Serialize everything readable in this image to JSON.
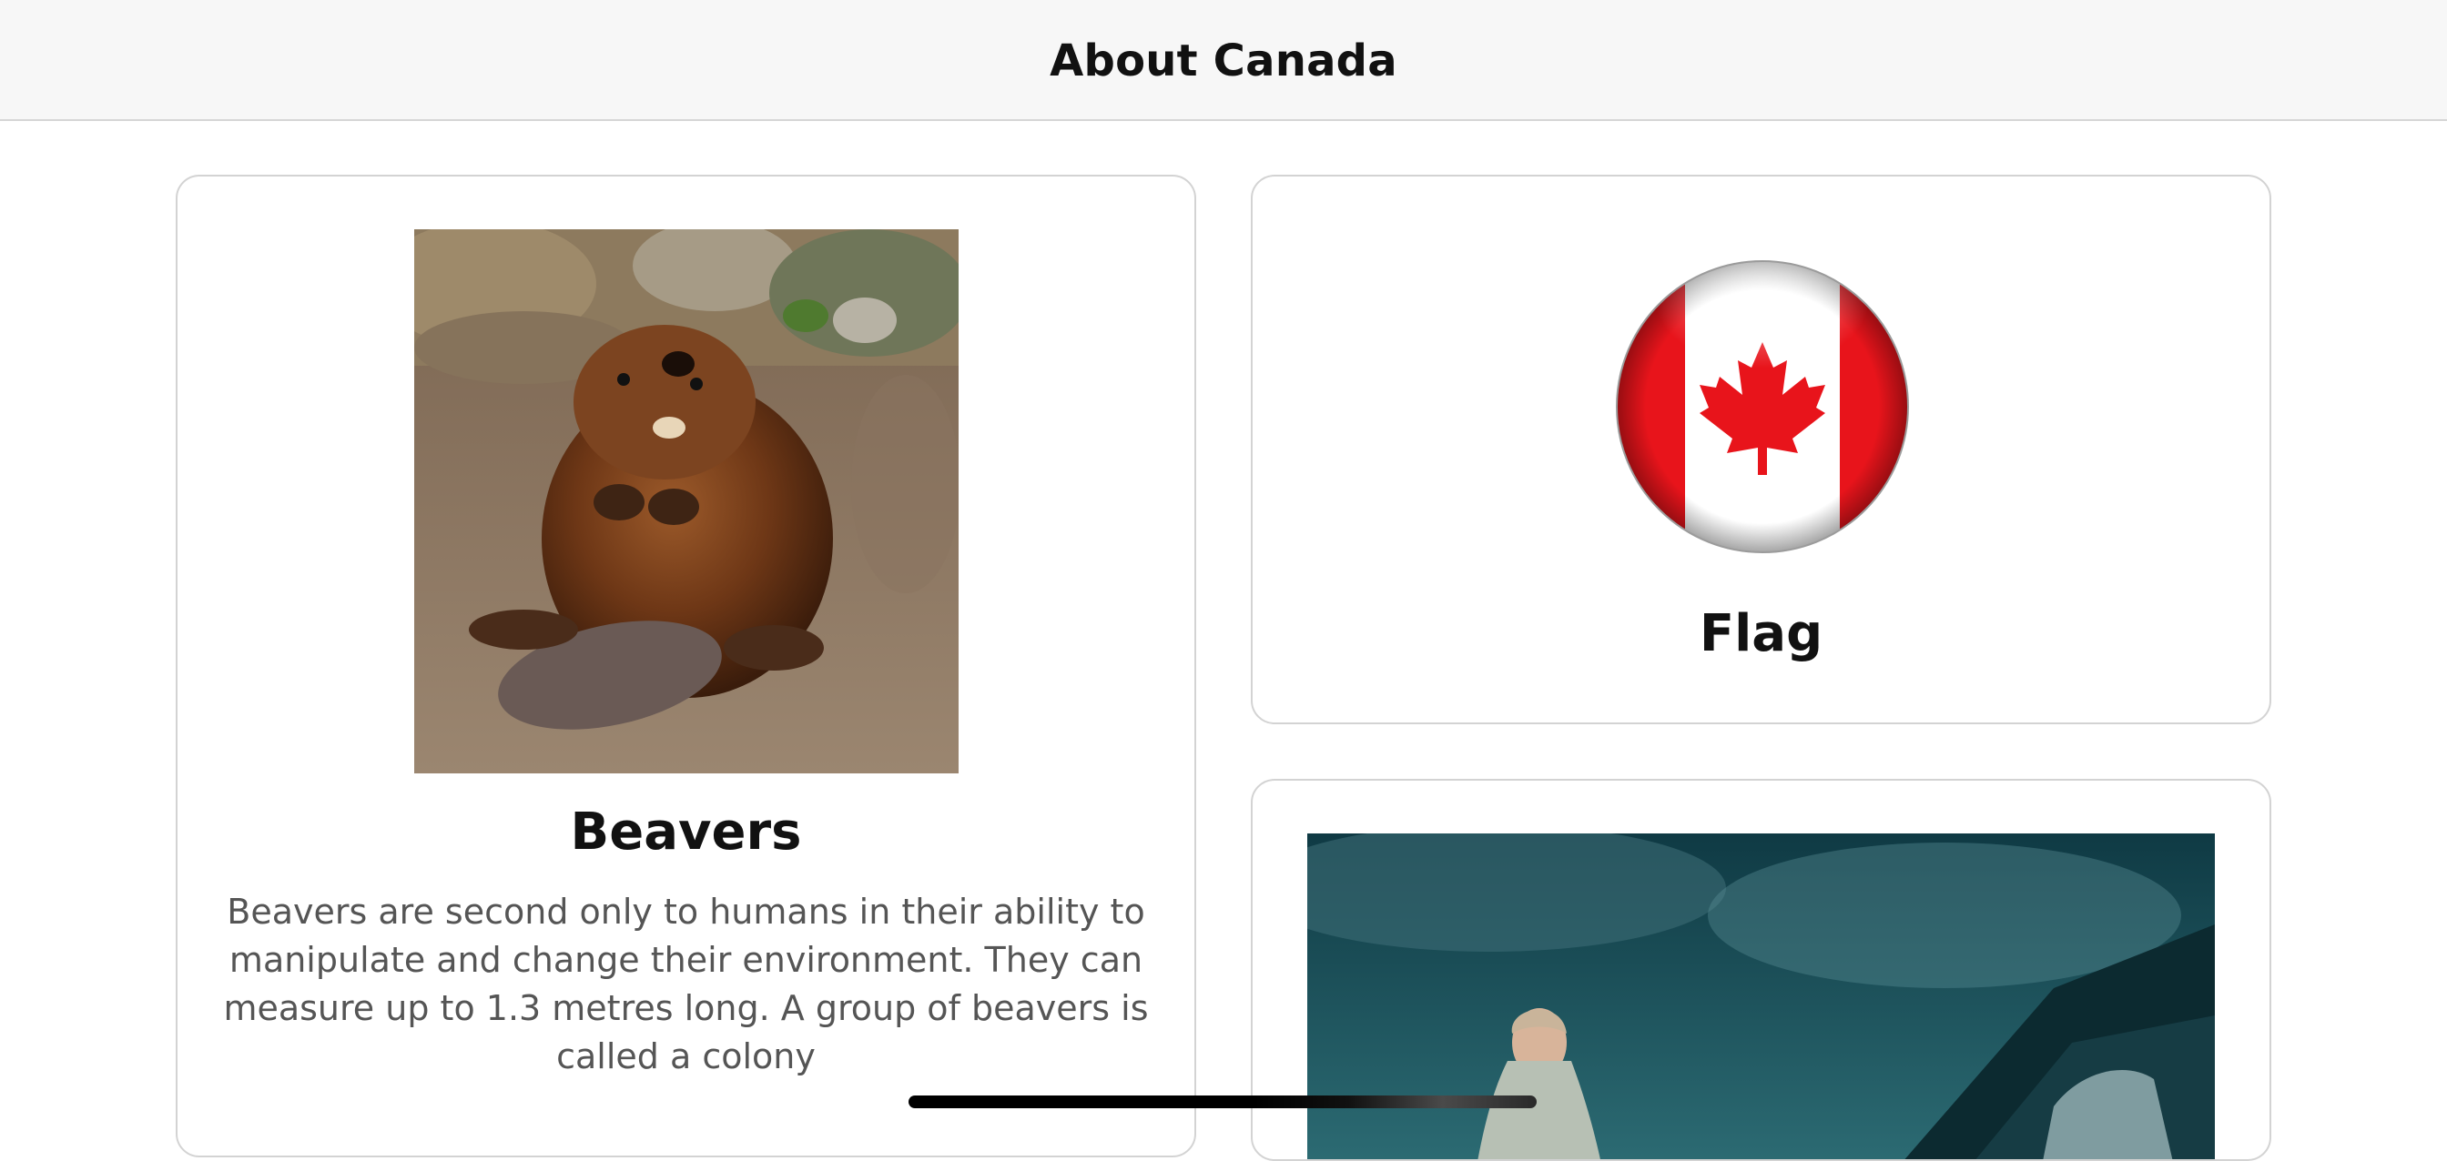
{
  "nav": {
    "title": "About Canada"
  },
  "cards": [
    {
      "title": "Beavers",
      "description": "Beavers are second only to humans in their ability to manipulate and change their environment. They can measure up to 1.3 metres long. A group of beavers is called a colony",
      "image": "beaver-photo"
    },
    {
      "title": "Flag",
      "image": "canada-flag-button"
    },
    {
      "image": "winter-scene-photo"
    }
  ],
  "colors": {
    "flag_red": "#e8141b",
    "nav_background": "#f7f7f7",
    "card_border": "#d3d3d3",
    "description_text": "#555555"
  }
}
